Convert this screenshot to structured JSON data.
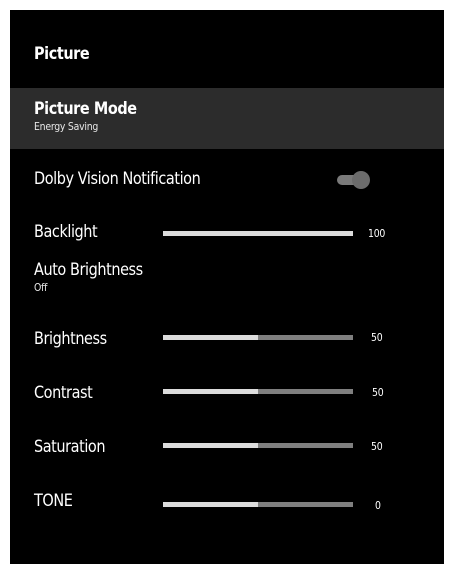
{
  "menu": {
    "title": "Picture",
    "picture_mode": {
      "label": "Picture Mode",
      "value": "Energy Saving"
    },
    "dolby_vision": {
      "label": "Dolby Vision Notification",
      "toggle_on": true
    },
    "backlight": {
      "label": "Backlight",
      "value": "100",
      "level": 1.0
    },
    "auto_brightness": {
      "label": "Auto Brightness",
      "value": "Off"
    },
    "brightness": {
      "label": "Brightness",
      "value": "50",
      "level": 0.5
    },
    "contrast": {
      "label": "Contrast",
      "value": "50",
      "level": 0.5
    },
    "saturation": {
      "label": "Saturation",
      "value": "50",
      "level": 0.5
    },
    "tone": {
      "label": "TONE",
      "value": "0",
      "level": 0.5
    }
  },
  "colors": {
    "background": "#000000",
    "selected_row": "#2c2c2c",
    "slider_fill": "#dcdcdc",
    "slider_track": "#7f7f7f"
  }
}
